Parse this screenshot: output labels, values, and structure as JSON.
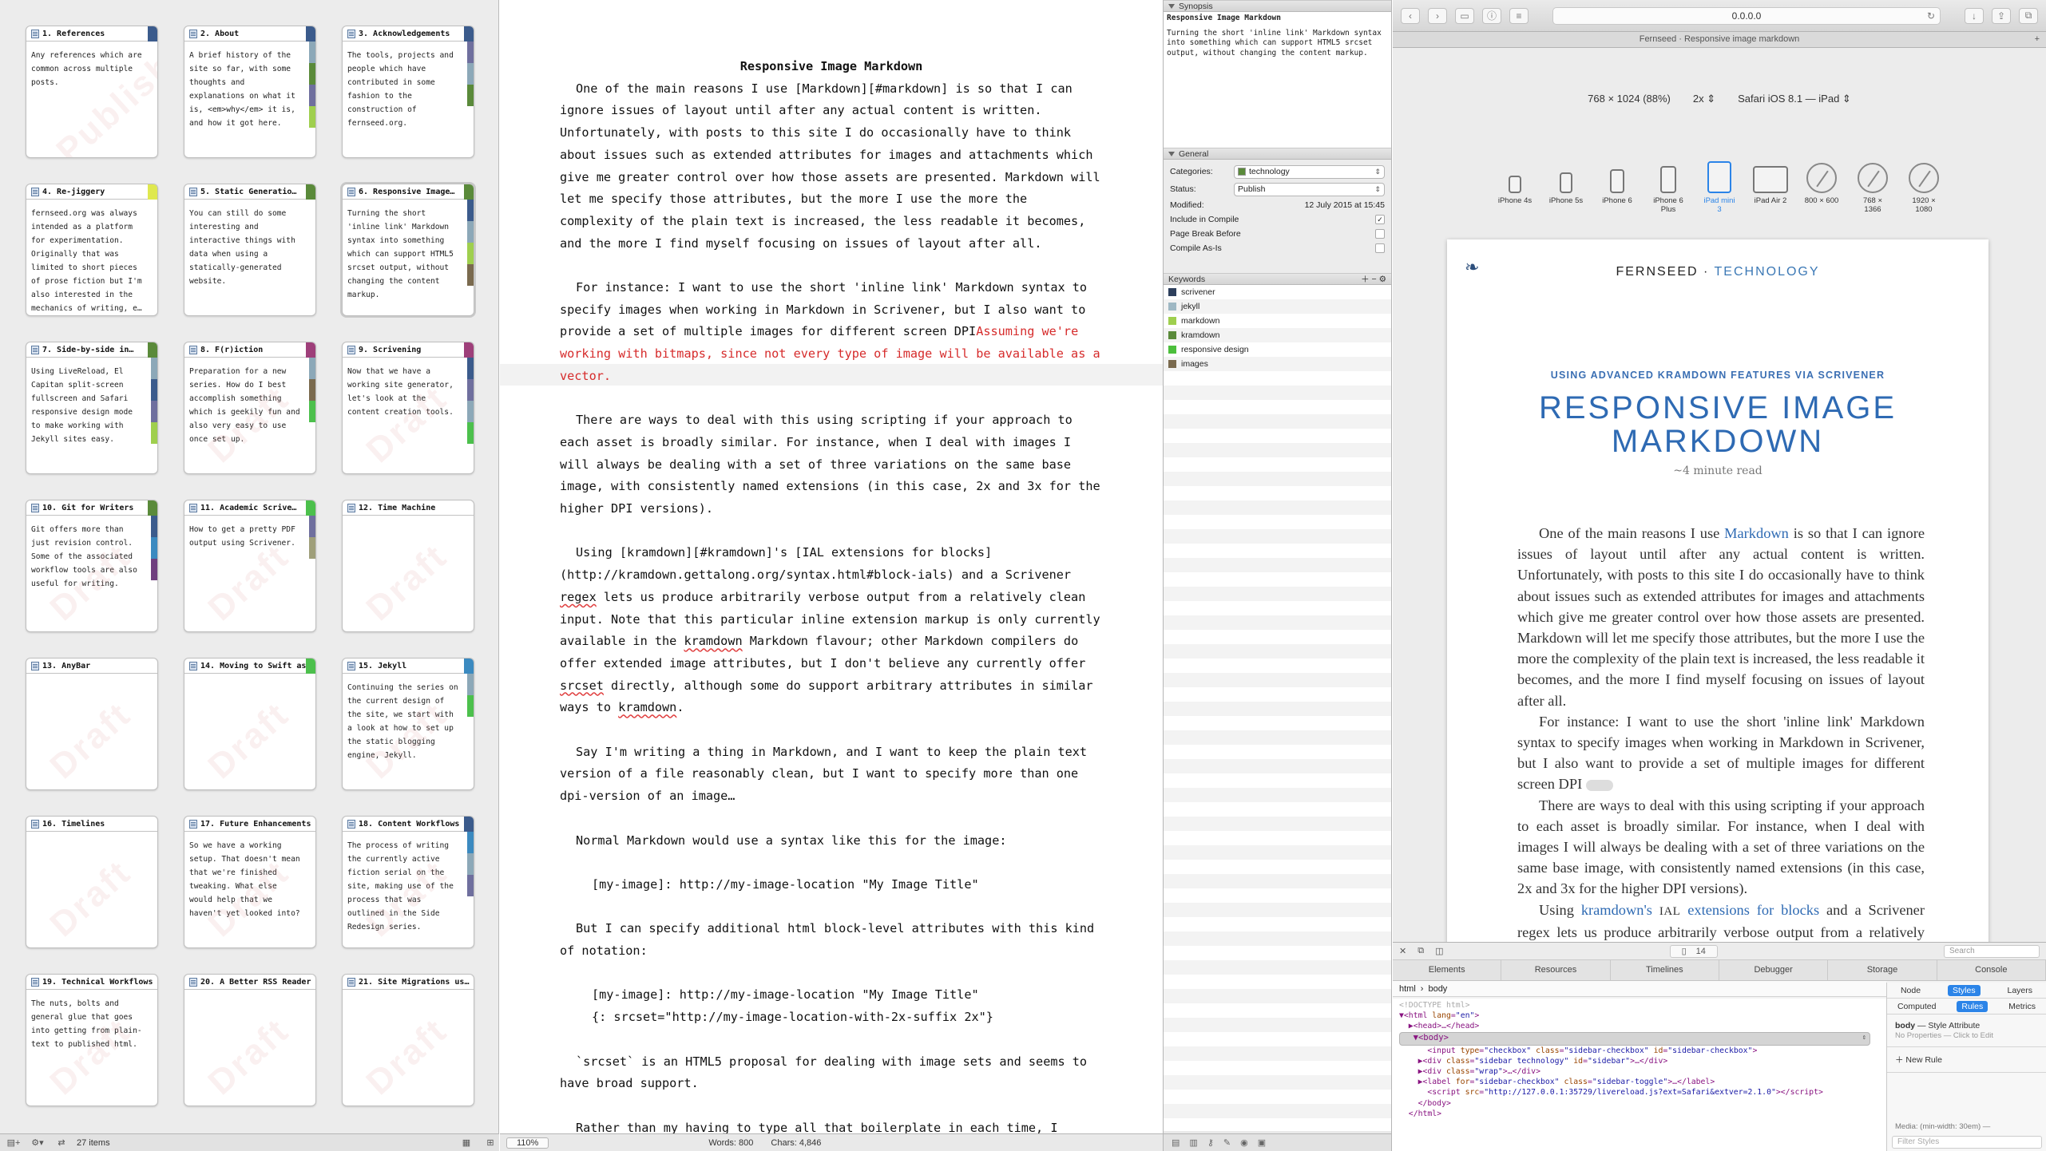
{
  "corkboard": {
    "cards": [
      {
        "title": "1. References",
        "body": "Any references which are common across multiple posts.",
        "stamp": "Publish",
        "colors": [
          "#3b5b8c"
        ]
      },
      {
        "title": "2. About",
        "body": "A brief history of the site so far, with some thoughts and explanations on what it is, <em>why</em> it is, and how it got here.",
        "stamp": "",
        "colors": [
          "#3b5b8c",
          "#8ca8b8",
          "#5a8a3a",
          "#6f6f9e",
          "#9fcf4e"
        ]
      },
      {
        "title": "3. Acknowledgements",
        "body": "The tools, projects and people which have contributed in some fashion to the construction of fernseed.org.",
        "stamp": "",
        "colors": [
          "#3b5b8c",
          "#6f6f9e",
          "#8ca8b8",
          "#5a8a3a"
        ]
      },
      {
        "title": "4. Re-jiggery",
        "body": "fernseed.org was always intended as a platform for experimentation. Originally that was limited to short pieces of prose fiction but I'm also interested in the mechanics of writing, e…",
        "stamp": "",
        "colors": [
          "#dfe84f"
        ]
      },
      {
        "title": "5. Static Generatio…",
        "body": "You can still do some interesting and interactive things with data when using a statically-generated website.",
        "stamp": "",
        "colors": [
          "#5a8a3a"
        ]
      },
      {
        "title": "6. Responsive Image…",
        "body": "Turning the short 'inline link' Markdown syntax into something which can support HTML5 srcset output, without changing the content markup.",
        "stamp": "",
        "colors": [
          "#5a8a3a",
          "#3b5b8c",
          "#8ca8b8",
          "#9fcf4e",
          "#7a6a4e"
        ]
      },
      {
        "title": "7. Side-by-side in…",
        "body": "Using LiveReload, El Capitan split-screen fullscreen and Safari responsive design mode to make working with Jekyll sites easy.",
        "stamp": "",
        "colors": [
          "#5a8a3a",
          "#8ca8b8",
          "#3b5b8c",
          "#6f6f9e",
          "#9fcf4e"
        ]
      },
      {
        "title": "8. F(r)iction",
        "body": "Preparation for a new series. How do I best accomplish something which is geekily fun and also very easy to use once set up.",
        "stamp": "Draft",
        "colors": [
          "#9e3f7a",
          "#8ca8b8",
          "#7a6a4e",
          "#4cc04c"
        ]
      },
      {
        "title": "9. Scrivening",
        "body": "Now that we have a working site generator, let's look at the content creation tools.",
        "stamp": "Draft",
        "colors": [
          "#9e3f7a",
          "#3b5b8c",
          "#6f6f9e",
          "#8ca8b8",
          "#4cc04c"
        ]
      },
      {
        "title": "10. Git for Writers",
        "body": "Git offers more than just revision control. Some of the associated workflow tools are also useful for writing.",
        "stamp": "Draft",
        "colors": [
          "#5a8a3a",
          "#3b5b8c",
          "#3b8ac0",
          "#6f3f7e"
        ]
      },
      {
        "title": "11. Academic Scrive…",
        "body": "How to get a pretty PDF output using Scrivener.",
        "stamp": "Draft",
        "colors": [
          "#4cc04c",
          "#6f6f9e",
          "#9f9f7a"
        ]
      },
      {
        "title": "12. Time Machine",
        "body": "",
        "stamp": "Draft",
        "colors": []
      },
      {
        "title": "13. AnyBar",
        "body": "",
        "stamp": "Draft",
        "colors": []
      },
      {
        "title": "14. Moving to Swift as…",
        "body": "",
        "stamp": "Draft",
        "colors": [
          "#4cc04c"
        ]
      },
      {
        "title": "15. Jekyll",
        "body": "Continuing the series on the current design of the site, we start with a look at how to set up the static blogging engine, Jekyll.",
        "stamp": "Draft",
        "colors": [
          "#3b8ac0",
          "#8ca8b8",
          "#4cc04c"
        ]
      },
      {
        "title": "16. Timelines",
        "body": "",
        "stamp": "Draft",
        "colors": []
      },
      {
        "title": "17. Future Enhancements",
        "body": "So we have a working setup. That doesn't mean that we're finished tweaking. What else would help that we haven't yet looked into?",
        "stamp": "Draft",
        "colors": []
      },
      {
        "title": "18. Content Workflows",
        "body": "The process of writing the currently active fiction serial on the site, making use of the process that was outlined in the Side Redesign series.",
        "stamp": "Draft",
        "colors": [
          "#3b5b8c",
          "#3b8ac0",
          "#8ca8b8",
          "#6f6f9e"
        ]
      },
      {
        "title": "19. Technical Workflows",
        "body": "The nuts, bolts and general glue that goes into getting from plain-text to published html.",
        "stamp": "Draft",
        "colors": []
      },
      {
        "title": "20. A Better RSS Reader",
        "body": "",
        "stamp": "Draft",
        "colors": []
      },
      {
        "title": "21. Site Migrations us…",
        "body": "",
        "stamp": "Draft",
        "colors": []
      }
    ],
    "status": {
      "items": "27 items"
    }
  },
  "editor": {
    "title": "Responsive Image Markdown",
    "p1": "One of the main reasons I use [Markdown][#markdown] is so that I can ignore issues of layout until after any actual content is written. Unfortunately, with posts to this site I do occasionally have to think about issues such as extended attributes for images and attachments which give me greater control over how those assets are presented. Markdown will let me specify those attributes, but the more I use the more the complexity of the plain text is increased, the less readable it becomes, and the more I find myself focusing on issues of layout after all.",
    "p2a": "For instance: I want to use the short 'inline link' Markdown syntax to specify images when working in Markdown in Scrivener, but I also want to provide a set of multiple images for different screen DPI",
    "p2comment": "Assuming we're working with bitmaps, since not every type of image will be available as a vector.",
    "p3": "There are ways to deal with this using scripting if your approach to each asset is broadly similar. For instance, when I deal with images I will always be dealing with a set of three variations on the same base image, with consistently named extensions (in this case, 2x and 3x for the higher DPI versions).",
    "p4a": "Using [kramdown][#kramdown]'s [IAL extensions for blocks](http://kramdown.gettalong.org/syntax.html#block-ials) and a Scrivener ",
    "p4regex": "regex",
    "p4b": " lets us produce arbitrarily verbose output from a relatively clean input. Note that this particular inline extension markup is only currently available in the ",
    "p4kramdown": "kramdown",
    "p4c": " Markdown flavour; other Markdown compilers do offer extended image attributes, but I don't believe any currently offer ",
    "p4srcset": "srcset",
    "p4d": " directly, although some do support arbitrary attributes in similar ways to ",
    "p4kramdown2": "kramdown",
    "p4e": ".",
    "p5": "Say I'm writing a thing in Markdown, and I want to keep the plain text version of a file reasonably clean, but I want to specify more than one dpi-version of an image…",
    "p6": "Normal Markdown would use a syntax like this for the image:",
    "code1": "[my-image]: http://my-image-location \"My Image Title\"",
    "p7": "But I can specify additional html block-level attributes with this kind of notation:",
    "code2a": "[my-image]: http://my-image-location \"My Image Title\"",
    "code2b": "{: srcset=\"http://my-image-location-with-2x-suffix 2x\"}",
    "p8": "`srcset` is an HTML5 proposal for dealing with image sets and seems to have broad support.",
    "p9": "Rather than my having to type all that boilerplate in each time, I",
    "status": {
      "zoom": "110%",
      "words": "Words: 800",
      "chars": "Chars: 4,846"
    }
  },
  "inspector": {
    "synopsis_label": "Synopsis",
    "synopsis_title": "Responsive Image Markdown",
    "synopsis_text": "Turning the short 'inline link' Markdown syntax into something which can support HTML5 srcset output, without changing the content markup.",
    "general_label": "General",
    "categories_label": "Categories:",
    "categories_value": "technology",
    "status_label": "Status:",
    "status_value": "Publish",
    "modified_label": "Modified:",
    "modified_value": "12 July 2015 at 15:45",
    "include_compile": "Include in Compile",
    "page_break": "Page Break Before",
    "compile_as_is": "Compile As-Is",
    "keywords_label": "Keywords",
    "keywords": [
      {
        "name": "scrivener",
        "color": "#2d3f5c"
      },
      {
        "name": "jekyll",
        "color": "#9fb8c4"
      },
      {
        "name": "markdown",
        "color": "#9fcf4e"
      },
      {
        "name": "kramdown",
        "color": "#5a8a3a"
      },
      {
        "name": "responsive design",
        "color": "#4cbf3c"
      },
      {
        "name": "images",
        "color": "#7a6a4e"
      }
    ]
  },
  "safari": {
    "url": "0.0.0.0",
    "tab_title": "Fernseed · Responsive image markdown",
    "viewport_size": "768 × 1024  (88%)",
    "scale": "2x",
    "device_ua": "Safari iOS 8.1 — iPad",
    "devices": [
      {
        "name": "iPhone 4s"
      },
      {
        "name": "iPhone 5s"
      },
      {
        "name": "iPhone 6"
      },
      {
        "name": "iPhone 6 Plus"
      },
      {
        "name": "iPad mini 3"
      },
      {
        "name": "iPad Air 2"
      },
      {
        "name": "800 × 600"
      },
      {
        "name": "768 × 1366"
      },
      {
        "name": "1920 × 1080"
      }
    ],
    "page": {
      "site": "FERNSEED",
      "sep": "·",
      "category": "TECHNOLOGY",
      "kicker": "USING ADVANCED KRAMDOWN FEATURES VIA SCRIVENER",
      "title": "RESPONSIVE IMAGE MARKDOWN",
      "readtime": "~4 minute read",
      "p1a": "One of the main reasons I use ",
      "p1link": "Markdown",
      "p1b": " is so that I can ignore issues of layout until after any actual content is written. Unfortunately, with posts to this site I do occasionally have to think about issues such as extended attributes for images and attachments which give me greater control over how those assets are presented. Markdown will let me specify those attributes, but the more I use the more the complexity of the plain text is increased, the less readable it becomes, and the more I find myself focusing on issues of layout after all.",
      "p2": "For instance: I want to use the short 'inline link' Markdown syntax to specify images when working in Markdown in Scrivener, but I also want to provide a set of multiple images for different screen DPI",
      "p3": "There are ways to deal with this using scripting if your approach to each asset is broadly similar. For instance, when I deal with images I will always be dealing with a set of three variations on the same base image, with consistently named extensions (in this case, 2x and 3x for the higher DPI versions).",
      "p4a": "Using ",
      "p4link1": "kramdown's",
      "p4ial": "IAL",
      "p4link2": "extensions for blocks",
      "p4b": " and a Scrivener regex lets us produce arbitrarily verbose output from a relatively clean input. Note that this particular inline extension markup is only currently available in the kramdown Markdown flavour; other Mark-"
    },
    "devtools": {
      "count_docs": "14",
      "search_placeholder": "Search",
      "tabs": [
        "Elements",
        "Resources",
        "Timelines",
        "Debugger",
        "Storage",
        "Console"
      ],
      "crumb_html": "html",
      "crumb_body": "body",
      "side_tabs": [
        "Node",
        "Styles",
        "Layers"
      ],
      "side_tabs2": [
        "Computed",
        "Rules",
        "Metrics"
      ],
      "rule_selector": "body",
      "rule_origin": "— Style Attribute",
      "rule_empty": "No Properties — Click to Edit",
      "new_rule": "New Rule",
      "media": "Media: (min-width: 30em) —",
      "filter_placeholder": "Filter Styles"
    }
  }
}
